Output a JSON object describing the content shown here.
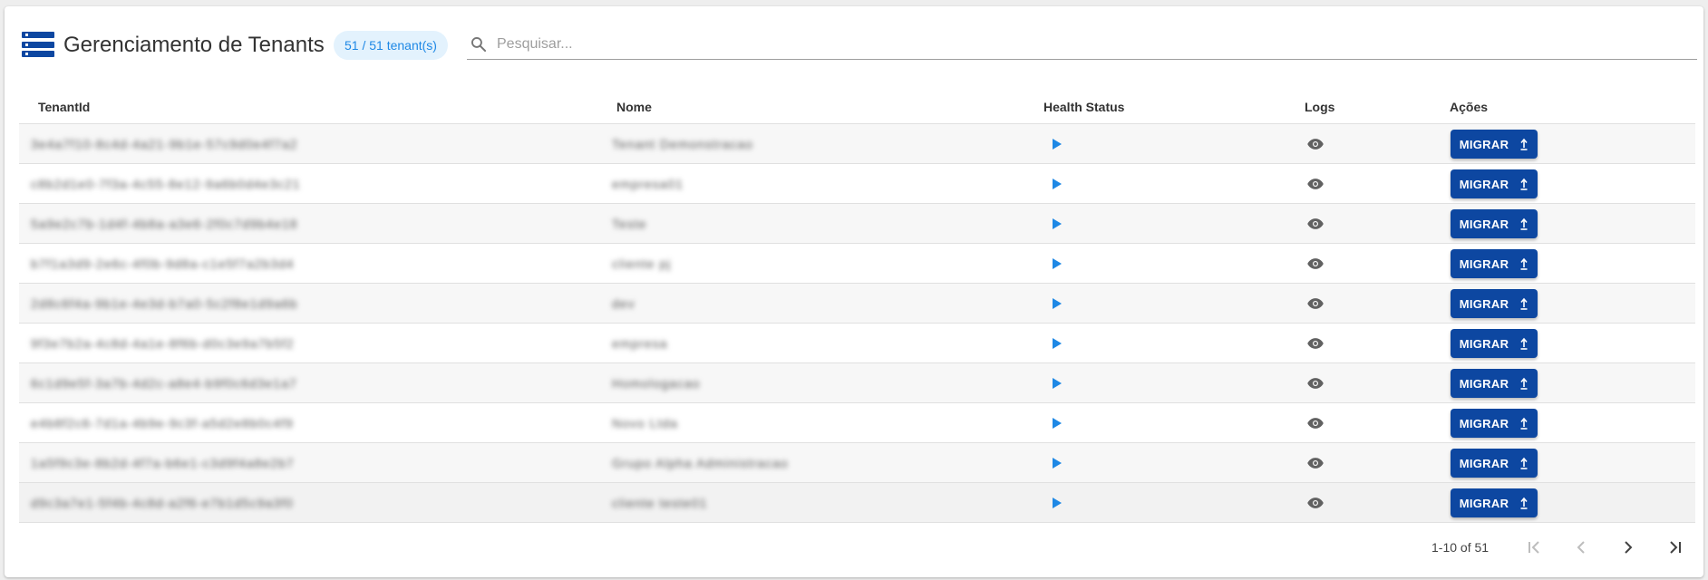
{
  "header": {
    "title": "Gerenciamento de Tenants",
    "count_badge": "51 / 51 tenant(s)",
    "search_placeholder": "Pesquisar..."
  },
  "table": {
    "columns": [
      "TenantId",
      "Nome",
      "Health Status",
      "Logs",
      "Ações"
    ],
    "rows": [
      {
        "tenant_id": "3e4a7f10-8c4d-4a21-9b1e-57c9d0e4f7a2",
        "nome": "Tenant Demonstracao",
        "action_label": "MIGRAR"
      },
      {
        "tenant_id": "c8b2d1e0-7f3a-4c55-8e12-9a6b0d4e3c21",
        "nome": "empresa01",
        "action_label": "MIGRAR"
      },
      {
        "tenant_id": "5a9e2c7b-1d4f-4b8a-a3e6-2f0c7d9b4e18",
        "nome": "Teste",
        "action_label": "MIGRAR"
      },
      {
        "tenant_id": "b7f1a3d9-2e6c-4f0b-9d8a-c1e5f7a2b3d4",
        "nome": "cliente pj",
        "action_label": "MIGRAR"
      },
      {
        "tenant_id": "2d8c6f4a-9b1e-4e3d-b7a0-5c2f8e1d9a6b",
        "nome": "dev",
        "action_label": "MIGRAR"
      },
      {
        "tenant_id": "9f3e7b2a-4c8d-4a1e-8f6b-d0c3e9a7b5f2",
        "nome": "empresa",
        "action_label": "MIGRAR"
      },
      {
        "tenant_id": "6c1d9e5f-3a7b-4d2c-a8e4-b9f0c6d3e1a7",
        "nome": "Homologacao",
        "action_label": "MIGRAR"
      },
      {
        "tenant_id": "e4b8f2c6-7d1a-4b9e-9c3f-a5d2e8b0c4f9",
        "nome": "Novo Ltda",
        "action_label": "MIGRAR"
      },
      {
        "tenant_id": "1a5f9c3e-8b2d-4f7a-b6e1-c3d9f4a8e2b7",
        "nome": "Grupo Alpha Administracao",
        "action_label": "MIGRAR"
      },
      {
        "tenant_id": "d9c3a7e1-5f4b-4c8d-a2f6-e7b1d5c9a3f0",
        "nome": "cliente teste01",
        "action_label": "MIGRAR"
      }
    ]
  },
  "pagination": {
    "range_text": "1-10 of 51"
  },
  "colors": {
    "primary": "#0d47a1",
    "accent": "#1e88e5",
    "badge_bg": "#e3f2fd",
    "icon_gray": "#616161"
  }
}
